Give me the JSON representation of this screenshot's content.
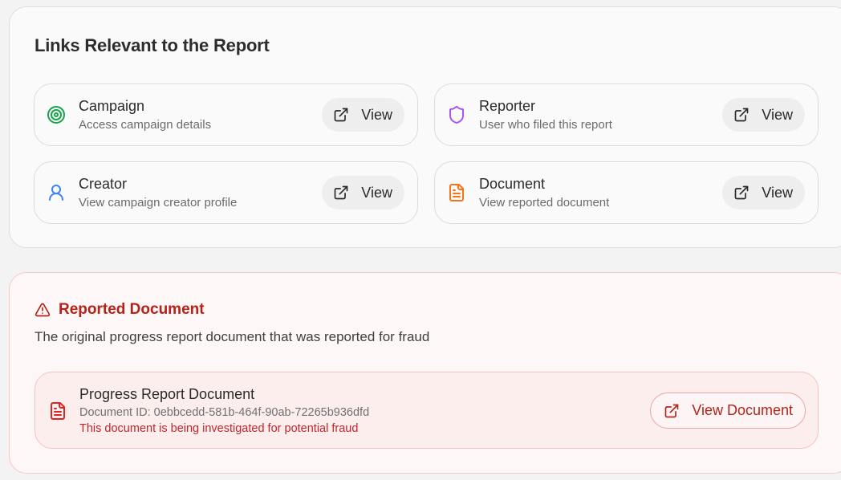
{
  "links_section": {
    "title": "Links Relevant to the Report",
    "items": [
      {
        "title": "Campaign",
        "subtitle": "Access campaign details",
        "button_label": "View",
        "icon": "target-icon",
        "color": "#16a34a"
      },
      {
        "title": "Reporter",
        "subtitle": "User who filed this report",
        "button_label": "View",
        "icon": "shield-icon",
        "color": "#a855f7"
      },
      {
        "title": "Creator",
        "subtitle": "View campaign creator profile",
        "button_label": "View",
        "icon": "user-icon",
        "color": "#3b82f6"
      },
      {
        "title": "Document",
        "subtitle": "View reported document",
        "button_label": "View",
        "icon": "file-text-icon",
        "color": "#f97316"
      }
    ]
  },
  "reported_document": {
    "title": "Reported Document",
    "description": "The original progress report document that was reported for fraud",
    "doc_title": "Progress Report Document",
    "doc_id": "Document ID: 0ebbcedd-581b-464f-90ab-72265b936dfd",
    "doc_warning": "This document is being investigated for potential fraud",
    "button_label": "View Document",
    "accent_color": "#b42318"
  }
}
